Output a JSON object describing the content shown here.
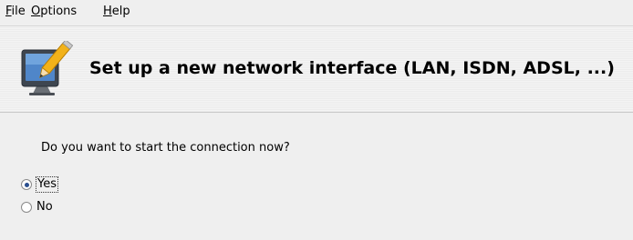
{
  "menubar": {
    "items": [
      {
        "label": "File",
        "mnemonic": "F",
        "rest": "ile"
      },
      {
        "label": "Options",
        "mnemonic": "O",
        "rest": "ptions"
      },
      {
        "label": "Help",
        "mnemonic": "H",
        "rest": "elp"
      }
    ]
  },
  "header": {
    "title": "Set up a new network interface (LAN, ISDN, ADSL, ...)",
    "icon": "network-wizard-icon"
  },
  "content": {
    "question": "Do you want to start the connection now?",
    "options": [
      {
        "label": "Yes",
        "selected": true
      },
      {
        "label": "No",
        "selected": false
      }
    ]
  },
  "colors": {
    "background": "#efefef",
    "radio_accent": "#2a4f8f"
  }
}
